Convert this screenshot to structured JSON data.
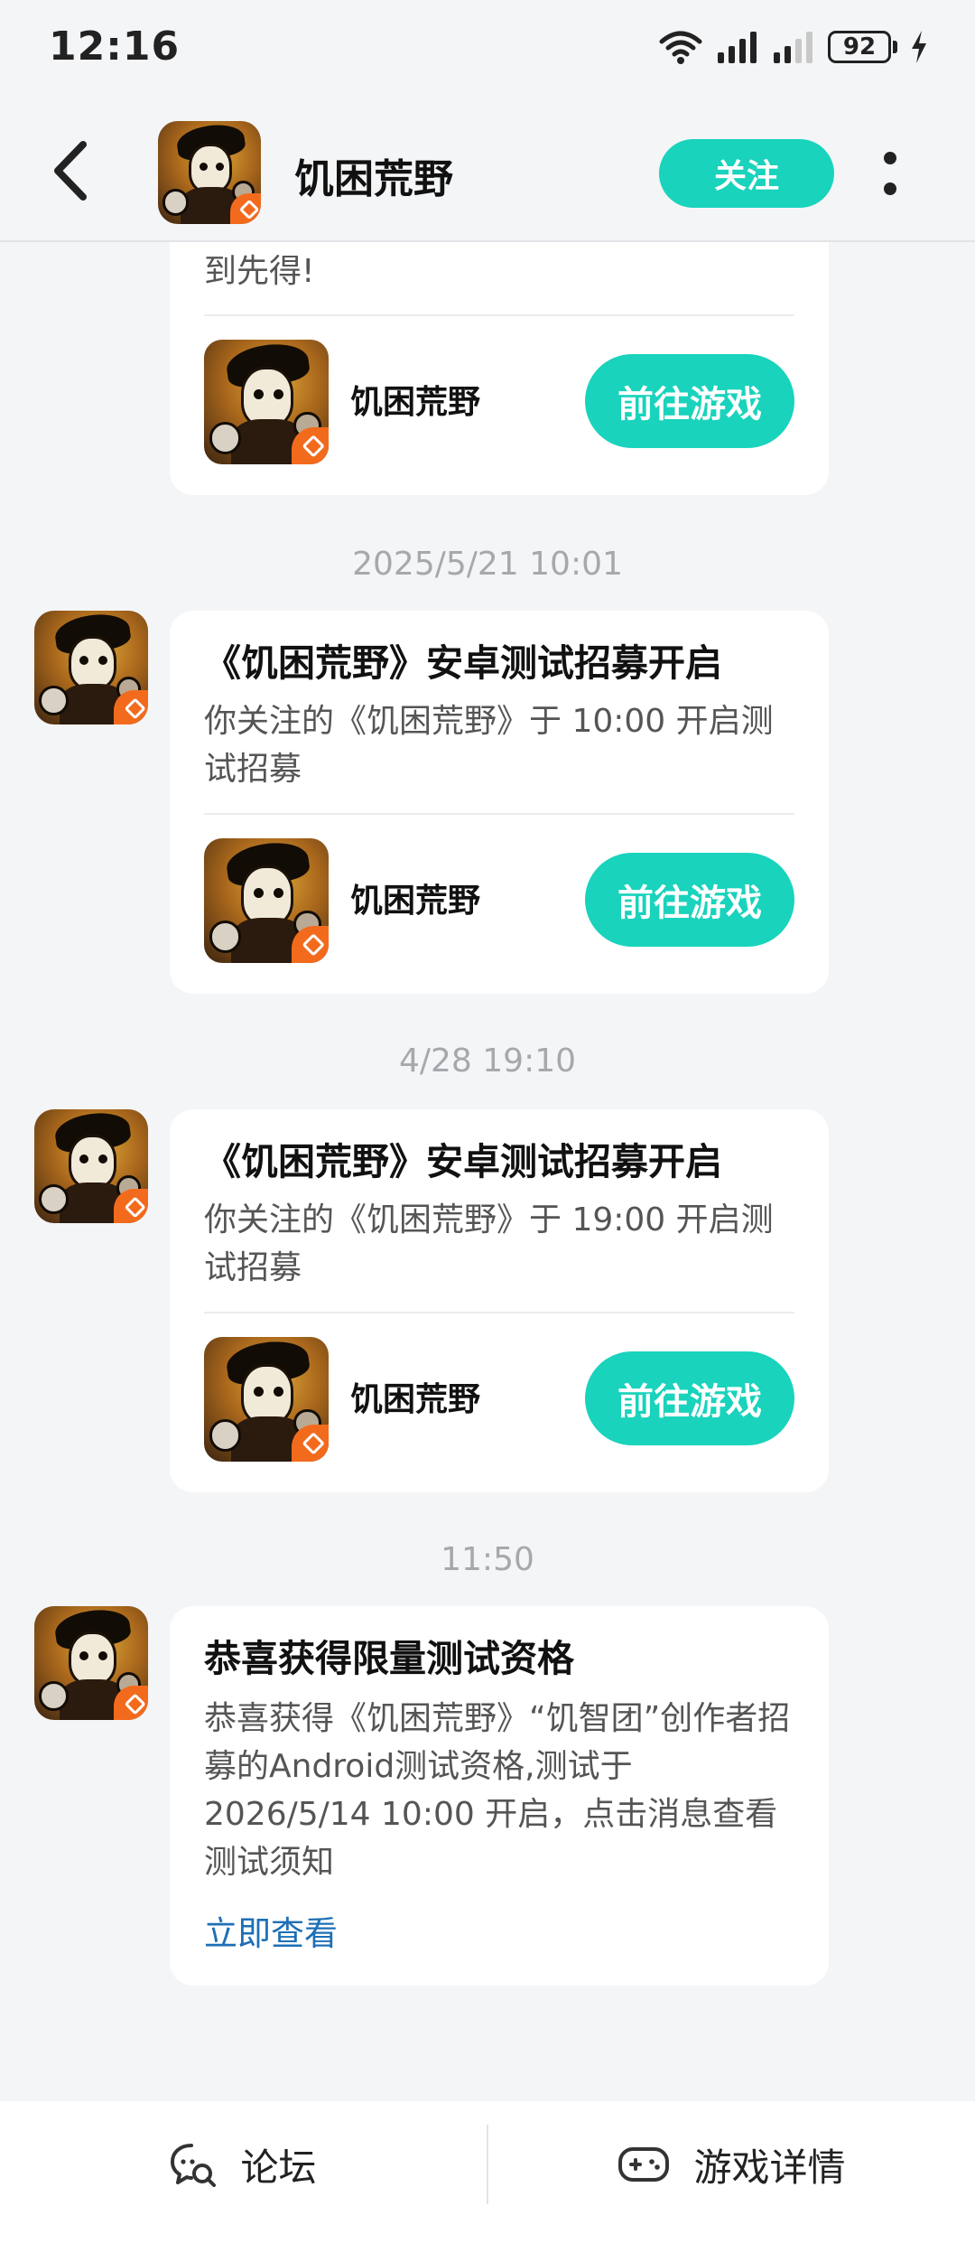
{
  "status_bar": {
    "time": "12:16",
    "battery": "92"
  },
  "header": {
    "title": "饥困荒野",
    "follow_label": "关注"
  },
  "messages": [
    {
      "partial_text": "到先得!",
      "game_name": "饥困荒野",
      "button_label": "前往游戏"
    },
    {
      "timestamp": "2025/5/21  10:01",
      "title": "《饥困荒野》安卓测试招募开启",
      "body": "你关注的《饥困荒野》于 10:00 开启测试招募",
      "game_name": "饥困荒野",
      "button_label": "前往游戏"
    },
    {
      "timestamp": "4/28  19:10",
      "title": "《饥困荒野》安卓测试招募开启",
      "body": "你关注的《饥困荒野》于 19:00 开启测试招募",
      "game_name": "饥困荒野",
      "button_label": "前往游戏"
    },
    {
      "timestamp": "11:50",
      "title": "恭喜获得限量测试资格",
      "body": "恭喜获得《饥困荒野》“饥智团”创作者招募的Android测试资格,测试于2026/5/14 10:00 开启，点击消息查看测试须知",
      "link_label": "立即查看"
    }
  ],
  "bottom_bar": {
    "forum_label": "论坛",
    "details_label": "游戏详情"
  },
  "colors": {
    "accent": "#19d3bc",
    "link": "#1d6fb5",
    "background": "#f4f5f7"
  }
}
